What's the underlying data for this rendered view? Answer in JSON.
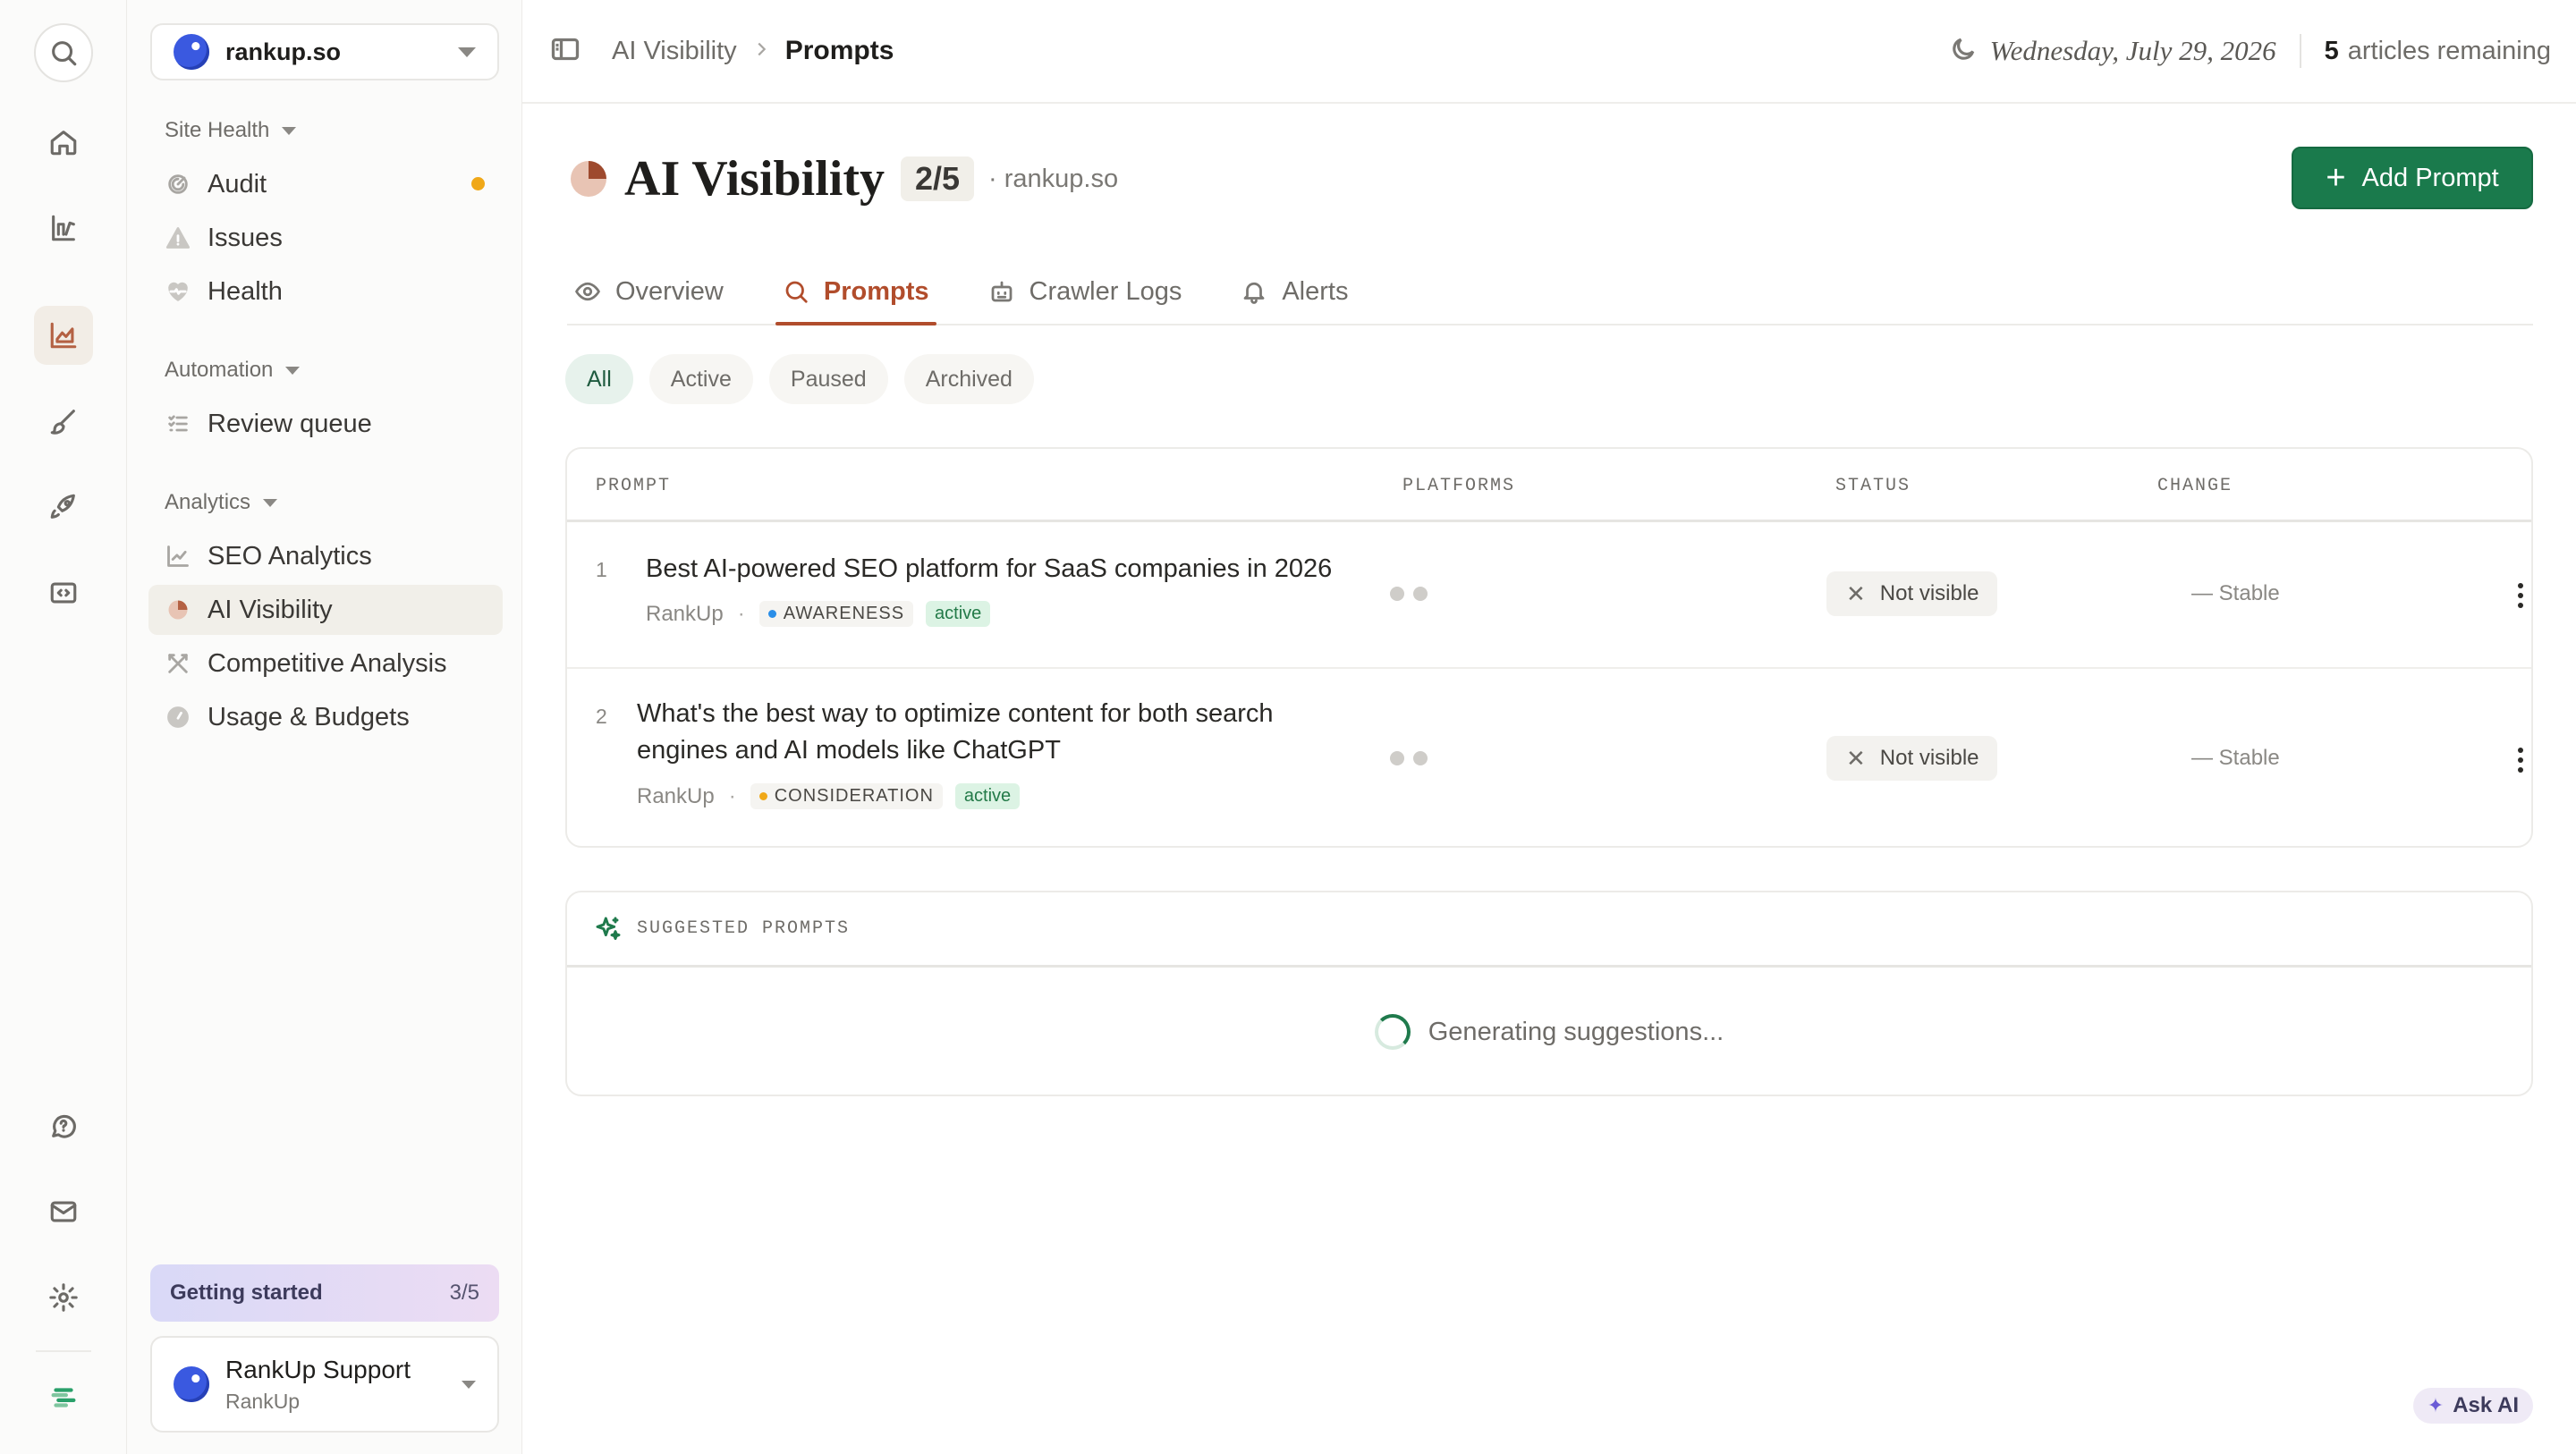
{
  "site": {
    "name": "rankup.so"
  },
  "sidebar": {
    "groups": [
      {
        "label": "Site Health",
        "items": [
          "Audit",
          "Issues",
          "Health"
        ]
      },
      {
        "label": "Automation",
        "items": [
          "Review queue"
        ]
      },
      {
        "label": "Analytics",
        "items": [
          "SEO Analytics",
          "AI Visibility",
          "Competitive Analysis",
          "Usage & Budgets"
        ]
      }
    ],
    "getting_started": {
      "label": "Getting started",
      "progress": "3/5"
    },
    "account": {
      "name": "RankUp Support",
      "org": "RankUp"
    }
  },
  "topbar": {
    "breadcrumb": [
      "AI Visibility",
      "Prompts"
    ],
    "date": "Wednesday, July 29, 2026",
    "articles_count": "5",
    "articles_label": "articles remaining"
  },
  "page": {
    "title": "AI Visibility",
    "quota": "2/5",
    "domain": "· rankup.so",
    "add_button": "Add Prompt"
  },
  "tabs": [
    "Overview",
    "Prompts",
    "Crawler Logs",
    "Alerts"
  ],
  "filters": [
    "All",
    "Active",
    "Paused",
    "Archived"
  ],
  "table": {
    "headers": [
      "PROMPT",
      "PLATFORMS",
      "STATUS",
      "CHANGE"
    ],
    "rows": [
      {
        "num": "1",
        "prompt": "Best AI-powered SEO platform for SaaS companies in 2026",
        "brand": "RankUp",
        "stage": "AWARENESS",
        "stage_color": "#2a8ee8",
        "state": "active",
        "status": "Not visible",
        "change": "— Stable"
      },
      {
        "num": "2",
        "prompt": "What's the best way to optimize content for both search engines and AI models like ChatGPT",
        "brand": "RankUp",
        "stage": "CONSIDERATION",
        "stage_color": "#f0a818",
        "state": "active",
        "status": "Not visible",
        "change": "— Stable"
      }
    ]
  },
  "suggested": {
    "title": "SUGGESTED PROMPTS",
    "loading": "Generating suggestions..."
  },
  "ask_ai": "Ask AI",
  "colors": {
    "accent": "#b14d2c",
    "primary": "#1a7a4c",
    "warning": "#f0a818"
  }
}
